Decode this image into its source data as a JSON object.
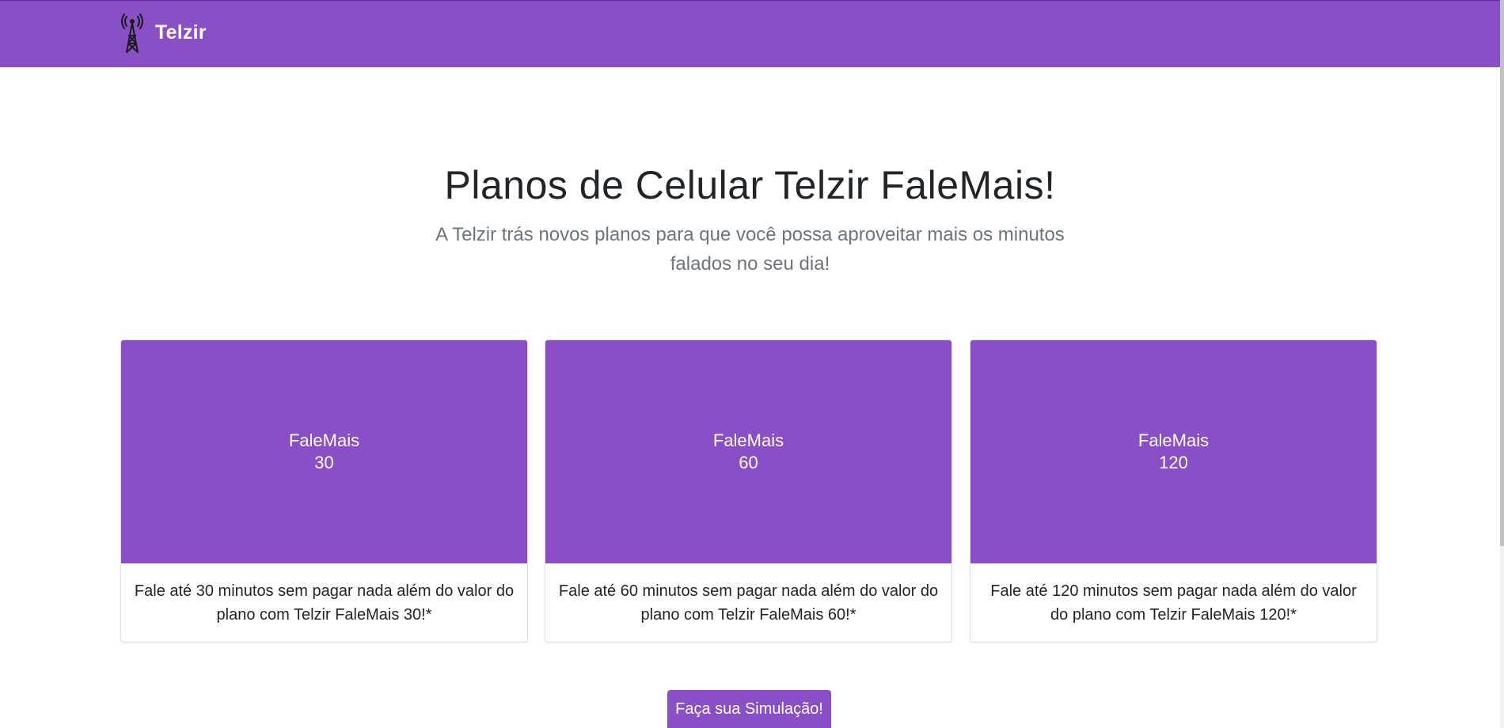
{
  "navbar": {
    "brand_icon": "radio-tower-icon",
    "brand_text": "Telzir",
    "background": "#8a4fc7"
  },
  "hero": {
    "title": "Planos de Celular Telzir FaleMais!",
    "subtitle": "A Telzir trás novos planos para que você possa aproveitar mais os minutos falados no seu dia!"
  },
  "plans": [
    {
      "name": "FaleMais",
      "minutes": "30",
      "description": "Fale até 30 minutos sem pagar nada além do valor do plano com Telzir FaleMais 30!*"
    },
    {
      "name": "FaleMais",
      "minutes": "60",
      "description": "Fale até 60 minutos sem pagar nada além do valor do plano com Telzir FaleMais 60!*"
    },
    {
      "name": "FaleMais",
      "minutes": "120",
      "description": "Fale até 120 minutos sem pagar nada além do valor do plano com Telzir FaleMais 120!*"
    }
  ],
  "cta": {
    "label": "Faça sua Simulação!"
  },
  "colors": {
    "accent": "#8a4fc7",
    "muted_text": "#6c757d"
  }
}
